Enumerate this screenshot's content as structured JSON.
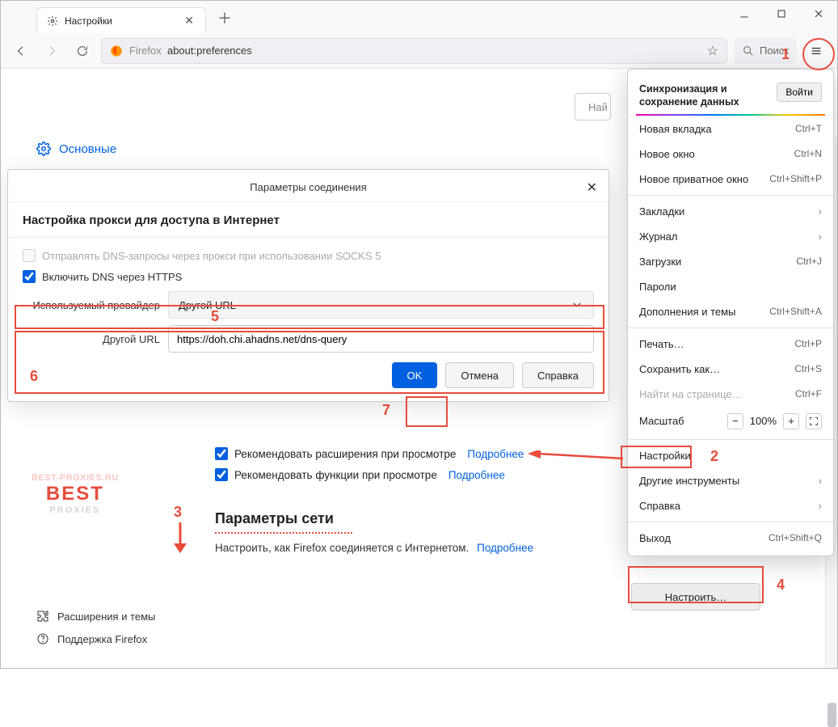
{
  "tab": {
    "title": "Настройки"
  },
  "url": {
    "prefix": "Firefox",
    "suffix": "about:preferences"
  },
  "toolbar": {
    "search_placeholder": "Поиск"
  },
  "leftnav": {
    "main": "Основные",
    "ext": "Расширения и темы",
    "support": "Поддержка Firefox"
  },
  "prefs_search_placeholder": "Най",
  "dialog": {
    "title": "Параметры соединения",
    "heading": "Настройка прокси для доступа в Интернет",
    "socks_label": "Отправлять DNS-запросы через прокси при использовании SOCKS 5",
    "doh_label": "Включить DNS через HTTPS",
    "provider_label": "Используемый провайдер",
    "provider_value": "Другой URL",
    "customurl_label": "Другой URL",
    "customurl_value": "https://doh.chi.ahadns.net/dns-query",
    "ok": "OK",
    "cancel": "Отмена",
    "help": "Справка"
  },
  "recommend": {
    "ext_label": "Рекомендовать расширения при просмотре",
    "fn_label": "Рекомендовать функции при просмотре",
    "more": "Подробнее"
  },
  "network": {
    "heading": "Параметры сети",
    "desc": "Настроить, как Firefox соединяется с Интернетом.",
    "more": "Подробнее",
    "configure_btn": "Настроить…"
  },
  "watermark": {
    "top": "BEST-PROXIES.RU",
    "mid": "BEST",
    "bot": "PROXIES"
  },
  "menu": {
    "sync_text": "Синхронизация и сохранение данных",
    "login": "Войти",
    "new_tab": "Новая вкладка",
    "new_tab_sc": "Ctrl+T",
    "new_window": "Новое окно",
    "new_window_sc": "Ctrl+N",
    "new_private": "Новое приватное окно",
    "new_private_sc": "Ctrl+Shift+P",
    "bookmarks": "Закладки",
    "history": "Журнал",
    "downloads": "Загрузки",
    "downloads_sc": "Ctrl+J",
    "passwords": "Пароли",
    "addons": "Дополнения и темы",
    "addons_sc": "Ctrl+Shift+A",
    "print": "Печать…",
    "print_sc": "Ctrl+P",
    "saveas": "Сохранить как…",
    "saveas_sc": "Ctrl+S",
    "find": "Найти на странице…",
    "find_sc": "Ctrl+F",
    "zoom": "Масштаб",
    "zoom_val": "100%",
    "settings": "Настройки",
    "more_tools": "Другие инструменты",
    "help": "Справка",
    "exit": "Выход",
    "exit_sc": "Ctrl+Shift+Q"
  },
  "markers": {
    "m1": "1",
    "m2": "2",
    "m3": "3",
    "m4": "4",
    "m5": "5",
    "m6": "6",
    "m7": "7"
  }
}
